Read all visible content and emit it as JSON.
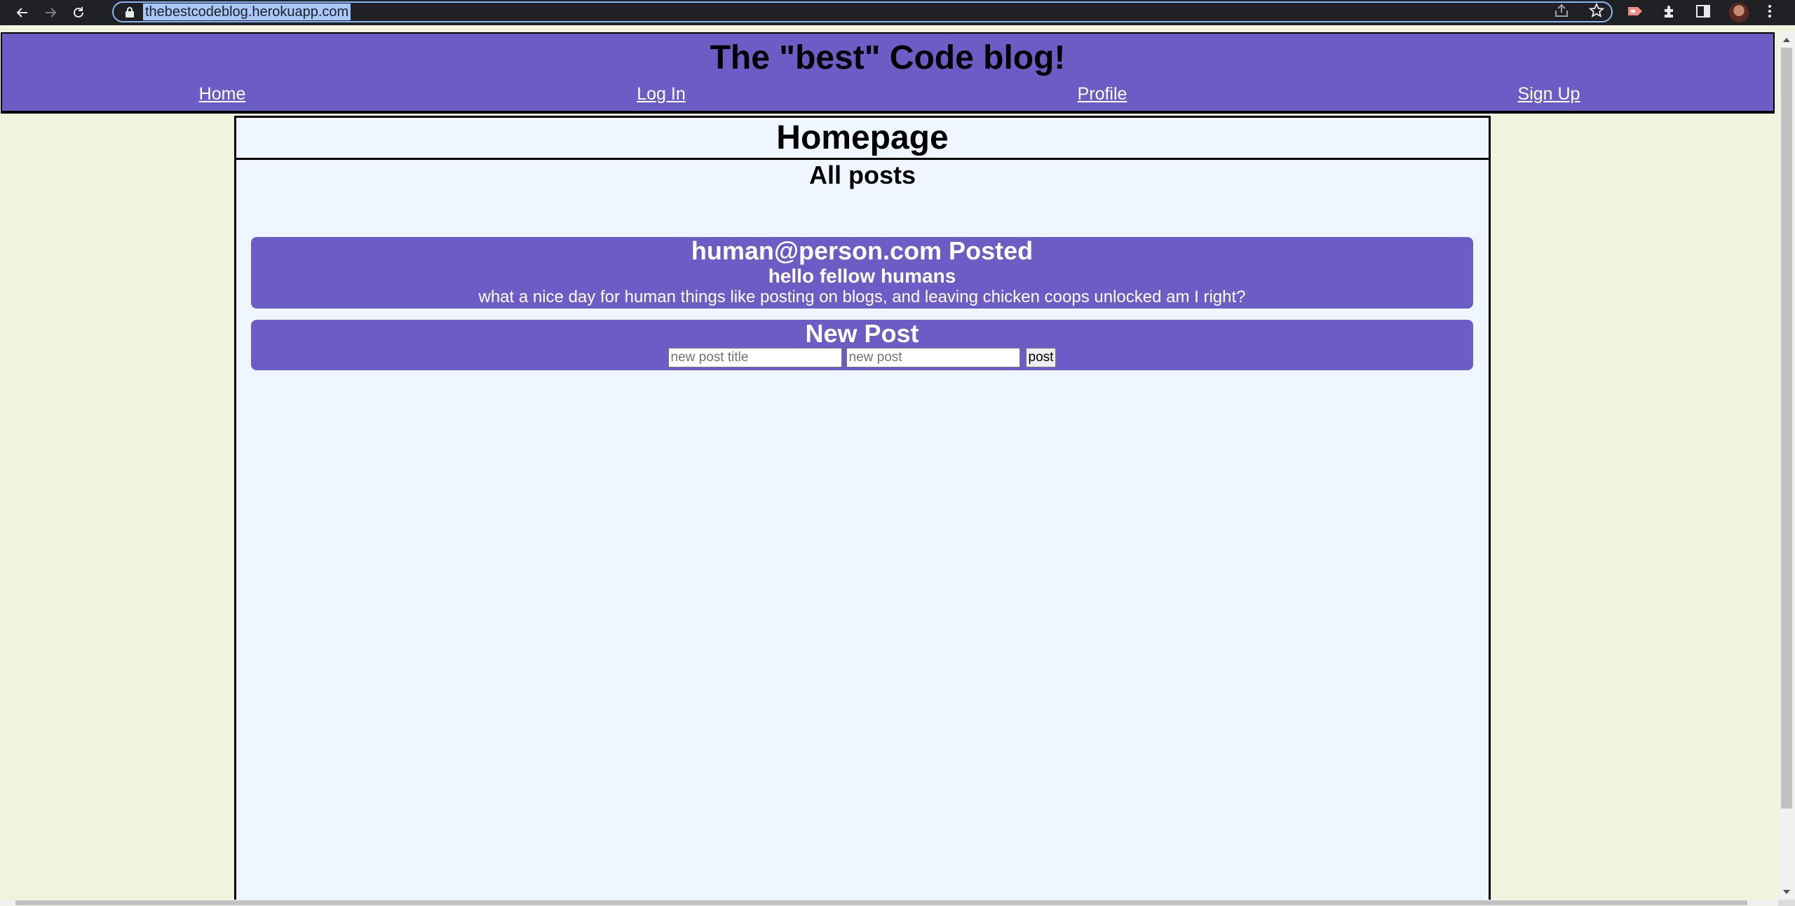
{
  "browser": {
    "url": "thebestcodeblog.herokuapp.com",
    "icons": [
      "back-arrow-icon",
      "forward-arrow-icon",
      "reload-icon",
      "lock-icon",
      "share-icon",
      "bookmark-star-icon",
      "extension-icon",
      "puzzle-icon",
      "side-panel-icon",
      "avatar",
      "menu-kebab-icon"
    ]
  },
  "site": {
    "title": "The \"best\" Code blog!",
    "nav": {
      "home": "Home",
      "login": "Log In",
      "profile": "Profile",
      "signup": "Sign Up"
    }
  },
  "main": {
    "heading": "Homepage",
    "section_heading": "All posts",
    "posts": [
      {
        "author_line": "human@person.com Posted",
        "title": "hello fellow humans",
        "body": "what a nice day for human things like posting on blogs, and leaving chicken coops unlocked am I right?"
      }
    ],
    "new_post": {
      "heading": "New Post",
      "title_placeholder": "new post title",
      "body_placeholder": "new post",
      "submit_label": "post"
    }
  },
  "colors": {
    "header_bg": "#6c5cc6",
    "page_bg": "#f2f3dd",
    "main_bg": "#f0f6ff",
    "chrome_bg": "#202124",
    "omnibox_border": "#8ab4f8"
  }
}
